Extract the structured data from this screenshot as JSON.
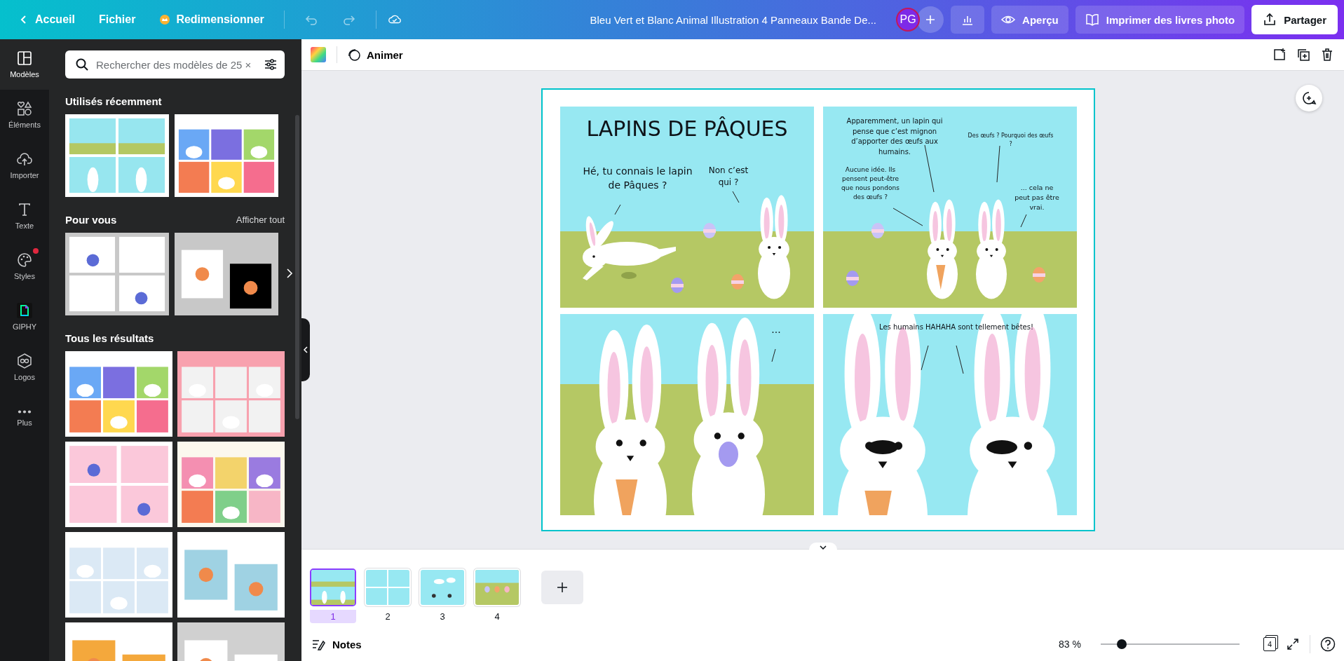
{
  "topbar": {
    "home": "Accueil",
    "menu": "Fichier",
    "resize": "Redimensionner",
    "title": "Bleu Vert et Blanc Animal Illustration 4 Panneaux Bande De...",
    "avatar": "PG",
    "preview": "Aperçu",
    "print": "Imprimer des livres photo",
    "share": "Partager"
  },
  "rail": [
    {
      "kind": "templates",
      "label": "Modèles",
      "selected": true,
      "notification": false
    },
    {
      "kind": "elements",
      "label": "Éléments",
      "selected": false,
      "notification": false
    },
    {
      "kind": "uploads",
      "label": "Importer",
      "selected": false,
      "notification": false
    },
    {
      "kind": "text",
      "label": "Texte",
      "selected": false,
      "notification": false
    },
    {
      "kind": "styles",
      "label": "Styles",
      "selected": false,
      "notification": true
    },
    {
      "kind": "giphy",
      "label": "GIPHY",
      "selected": false,
      "notification": false
    },
    {
      "kind": "logos",
      "label": "Logos",
      "selected": false,
      "notification": false
    },
    {
      "kind": "more",
      "label": "Plus",
      "selected": false,
      "notification": false
    }
  ],
  "panel": {
    "search": {
      "placeholder": "Rechercher des modèles de 25 ×"
    },
    "sections": [
      {
        "title": "Utilisés récemment"
      },
      {
        "title": "Pour vous",
        "link": "Afficher tout"
      },
      {
        "title": "Tous les résultats"
      }
    ]
  },
  "editor": {
    "animate": "Animer"
  },
  "design": {
    "panels": [
      {
        "title": "LAPINS DE PÂQUES",
        "bubbles": [
          "Hé, tu connais le lapin de Pâques ?",
          "Non c’est qui ?"
        ]
      },
      {
        "bubbles": [
          "Apparemment, un lapin qui pense que c’est mignon d’apporter des œufs aux humains.",
          "Des œufs ? Pourquoi des œufs ?",
          "Aucune idée. Ils pensent peut-être que nous pondons des œufs ?",
          "... cela ne peut pas être vrai."
        ]
      },
      {
        "bubbles": [
          "..."
        ]
      },
      {
        "bubbles": [
          "Les humains HAHAHA sont tellement bêtes!"
        ]
      }
    ]
  },
  "pages": [
    {
      "label": "1",
      "selected": true
    },
    {
      "label": "2",
      "selected": false
    },
    {
      "label": "3",
      "selected": false
    },
    {
      "label": "4",
      "selected": false
    }
  ],
  "footer": {
    "notes": "Notes",
    "zoom": "83 %",
    "zoom_slider": {
      "level": 0.15
    },
    "page_count": "4"
  }
}
